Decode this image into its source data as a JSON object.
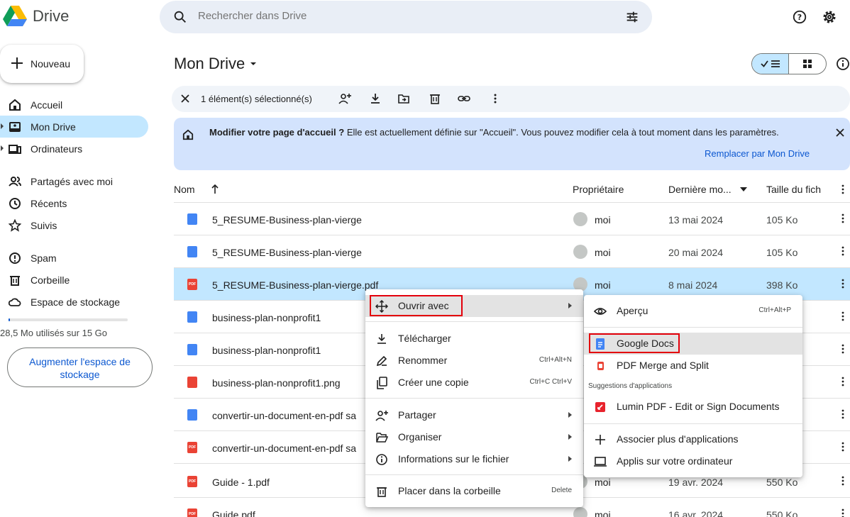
{
  "app": {
    "title": "Drive"
  },
  "search": {
    "placeholder": "Rechercher dans Drive"
  },
  "sidebar": {
    "new_label": "Nouveau",
    "items": [
      {
        "label": "Accueil",
        "icon": "home-icon"
      },
      {
        "label": "Mon Drive",
        "icon": "drive-icon",
        "active": true
      },
      {
        "label": "Ordinateurs",
        "icon": "computers-icon"
      },
      {
        "label": "Partagés avec moi",
        "icon": "shared-icon"
      },
      {
        "label": "Récents",
        "icon": "clock-icon"
      },
      {
        "label": "Suivis",
        "icon": "star-icon"
      },
      {
        "label": "Spam",
        "icon": "spam-icon"
      },
      {
        "label": "Corbeille",
        "icon": "trash-icon"
      },
      {
        "label": "Espace de stockage",
        "icon": "cloud-icon"
      }
    ],
    "storage_text": "28,5 Mo utilisés sur 15 Go",
    "upgrade_label": "Augmenter l'espace de stockage"
  },
  "main": {
    "title": "Mon Drive",
    "selection": {
      "count_text": "1 élément(s) sélectionné(s)"
    },
    "banner": {
      "bold_text": "Modifier votre page d'accueil ?",
      "text": " Elle est actuellement définie sur \"Accueil\". Vous pouvez modifier cela à tout moment dans les paramètres.",
      "link": "Remplacer par Mon Drive"
    },
    "columns": {
      "name": "Nom",
      "owner": "Propriétaire",
      "modified": "Dernière mo...",
      "size": "Taille du fich"
    },
    "rows": [
      {
        "name": "5_RESUME-Business-plan-vierge",
        "type": "doc",
        "owner": "moi",
        "date": "13 mai 2024",
        "size": "105 Ko"
      },
      {
        "name": "5_RESUME-Business-plan-vierge",
        "type": "doc",
        "owner": "moi",
        "date": "20 mai 2024",
        "size": "105 Ko"
      },
      {
        "name": "5_RESUME-Business-plan-vierge.pdf",
        "type": "pdf",
        "owner": "moi",
        "date": "8 mai 2024",
        "size": "398 Ko",
        "selected": true
      },
      {
        "name": "business-plan-nonprofit1",
        "type": "doc",
        "owner": "",
        "date": "",
        "size": ""
      },
      {
        "name": "business-plan-nonprofit1",
        "type": "doc",
        "owner": "",
        "date": "",
        "size": ""
      },
      {
        "name": "business-plan-nonprofit1.png",
        "type": "img",
        "owner": "",
        "date": "",
        "size": ""
      },
      {
        "name": "convertir-un-document-en-pdf sa",
        "type": "doc",
        "owner": "",
        "date": "",
        "size": ""
      },
      {
        "name": "convertir-un-document-en-pdf sa",
        "type": "pdf",
        "owner": "",
        "date": "",
        "size": ""
      },
      {
        "name": "Guide - 1.pdf",
        "type": "pdf",
        "owner": "moi",
        "date": "19 avr. 2024",
        "size": "550 Ko"
      },
      {
        "name": "Guide.pdf",
        "type": "pdf",
        "owner": "moi",
        "date": "16 avr. 2024",
        "size": "550 Ko"
      }
    ]
  },
  "context_menu": {
    "open_with": "Ouvrir avec",
    "download": "Télécharger",
    "rename": "Renommer",
    "rename_shortcut": "Ctrl+Alt+N",
    "copy": "Créer une copie",
    "copy_shortcut": "Ctrl+C Ctrl+V",
    "share": "Partager",
    "organize": "Organiser",
    "file_info": "Informations sur le fichier",
    "trash": "Placer dans la corbeille",
    "trash_shortcut": "Delete"
  },
  "submenu": {
    "preview": "Aperçu",
    "preview_shortcut": "Ctrl+Alt+P",
    "google_docs": "Google Docs",
    "pdf_merge": "PDF Merge and Split",
    "suggestions_label": "Suggestions d'applications",
    "lumin": "Lumin PDF - Edit or Sign Documents",
    "connect_more": "Associer plus d'applications",
    "desktop_apps": "Applis sur votre ordinateur"
  },
  "colors": {
    "accent": "#0b57d0",
    "selected": "#c2e7ff",
    "highlight_box": "#e3000b"
  }
}
